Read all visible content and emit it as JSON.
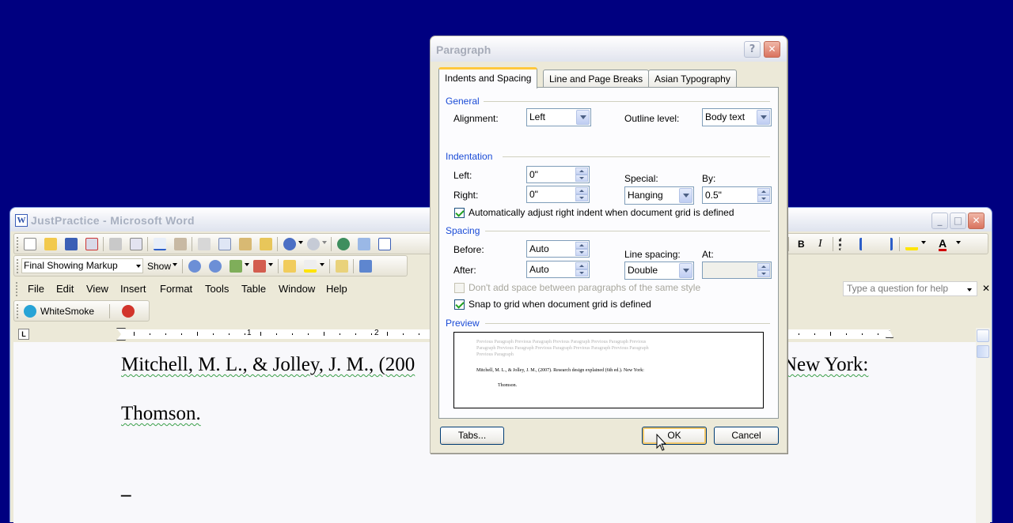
{
  "word": {
    "title": "JustPractice - Microsoft Word",
    "app_icon": "W",
    "caption_buttons": {
      "minimize": "_",
      "maximize": "□",
      "close": "✕"
    },
    "review_toolbar": {
      "markup_dropdown": "Final Showing Markup",
      "show_label": "Show"
    },
    "whitesmoke_label": "WhiteSmoke",
    "menu": [
      "File",
      "Edit",
      "View",
      "Insert",
      "Format",
      "Tools",
      "Table",
      "Window",
      "Help"
    ],
    "help_placeholder": "Type a question for help",
    "help_close": "✕",
    "formatting": {
      "bold": "B",
      "italic": "I",
      "font_color": "A"
    },
    "ruler_numbers": [
      "1",
      "2"
    ],
    "document_lines": [
      "Mitchell, M. L., & Jolley, J. M., (200",
      "New York:",
      "Thomson."
    ],
    "cursor": "_"
  },
  "dialog": {
    "title": "Paragraph",
    "help_button": "?",
    "close_button": "✕",
    "tabs": [
      "Indents and Spacing",
      "Line and Page Breaks",
      "Asian Typography"
    ],
    "general": {
      "title": "General",
      "alignment_label": "Alignment:",
      "alignment_value": "Left",
      "outline_label": "Outline level:",
      "outline_value": "Body text"
    },
    "indentation": {
      "title": "Indentation",
      "left_label": "Left:",
      "left_value": "0\"",
      "right_label": "Right:",
      "right_value": "0\"",
      "special_label": "Special:",
      "special_value": "Hanging",
      "by_label": "By:",
      "by_value": "0.5\"",
      "auto_adjust_label": "Automatically adjust right indent when document grid is defined",
      "auto_adjust_checked": true
    },
    "spacing": {
      "title": "Spacing",
      "before_label": "Before:",
      "before_value": "Auto",
      "after_label": "After:",
      "after_value": "Auto",
      "line_spacing_label": "Line spacing:",
      "line_spacing_value": "Double",
      "at_label": "At:",
      "at_value": "",
      "dont_add_label": "Don't add space between paragraphs of the same style",
      "dont_add_checked": false,
      "snap_label": "Snap to grid when document grid is defined",
      "snap_checked": true
    },
    "preview": {
      "title": "Preview",
      "previous_lines": [
        "Previous Paragraph Previous Paragraph Previous Paragraph Previous Paragraph Previous",
        "Paragraph Previous Paragraph Previous Paragraph Previous Paragraph Previous Paragraph",
        "Previous Paragraph"
      ],
      "sample_line1": "Mitchell, M. L., & Jolley, J. M., (2007). Research design explained (6th ed.). New York:",
      "sample_line2": "Thomson."
    },
    "buttons": {
      "tabs": "Tabs...",
      "ok": "OK",
      "cancel": "Cancel"
    }
  }
}
